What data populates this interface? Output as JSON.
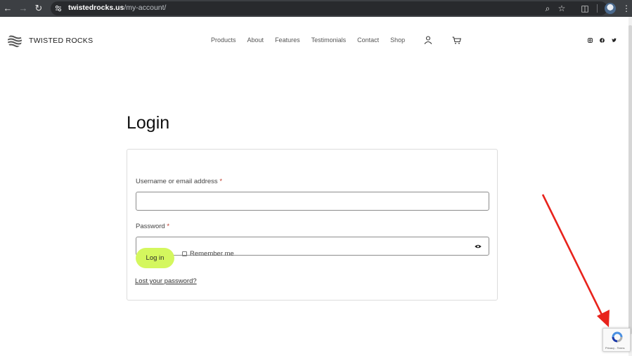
{
  "browser": {
    "url_host": "twistedrocks.us",
    "url_path": "/my-account/"
  },
  "site": {
    "brand": "TWISTED ROCKS",
    "nav": [
      "Products",
      "About",
      "Features",
      "Testimonials",
      "Contact",
      "Shop"
    ],
    "social_icons": [
      "instagram-icon",
      "facebook-icon",
      "twitter-icon"
    ]
  },
  "login": {
    "title": "Login",
    "username_label": "Username or email address",
    "password_label": "Password",
    "required_mark": "*",
    "username_value": "",
    "password_value": "",
    "login_button": "Log in",
    "remember_label": "Remember me",
    "lost_password_link": "Lost your password?"
  },
  "recaptcha": {
    "footer_text": "Privacy - Terms"
  },
  "colors": {
    "login_button_bg": "#d4f75e",
    "annotation_arrow": "#e8231c",
    "required_mark": "#c0392b"
  }
}
